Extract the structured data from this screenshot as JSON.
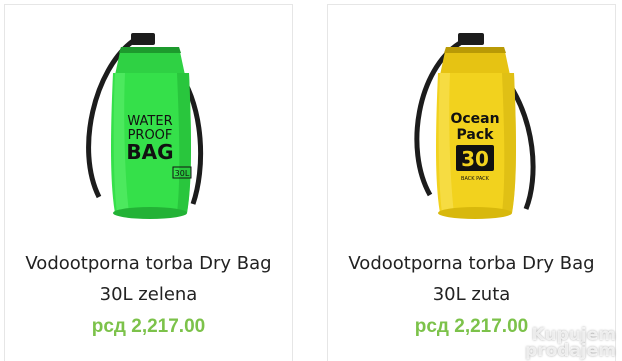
{
  "products": [
    {
      "title": "Vodootporna torba Dry Bag 30L zelena",
      "price": "рсд 2,217.00",
      "image": {
        "icon": "green-dry-bag-image",
        "color": "#35e04a",
        "label_lines": [
          "WATER",
          "PROOF",
          "BAG"
        ],
        "badge": "30L"
      }
    },
    {
      "title": "Vodootporna torba Dry Bag 30L zuta",
      "price": "рсд 2,217.00",
      "image": {
        "icon": "yellow-dry-bag-image",
        "color": "#f2d21e",
        "label_lines": [
          "Ocean",
          "Pack"
        ],
        "badge": "30",
        "sub_label": "BACK PACK"
      }
    }
  ],
  "watermark": {
    "line1": "Kupujem",
    "line2": "prodajem"
  },
  "colors": {
    "price": "#7cc24a",
    "title": "#222222",
    "border": "#e6e6e6"
  }
}
